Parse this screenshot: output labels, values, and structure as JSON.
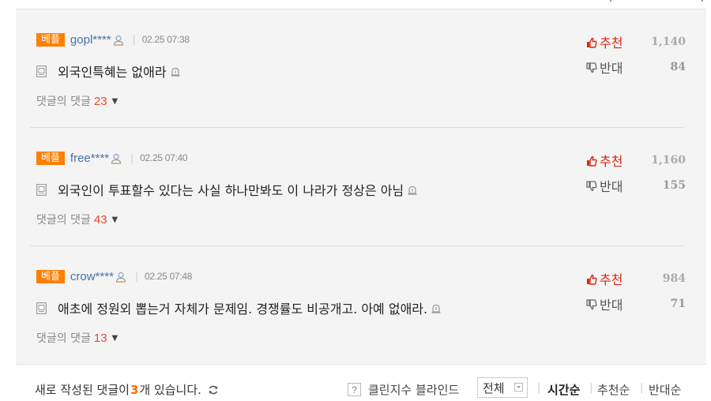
{
  "comments": [
    {
      "badge": "베플",
      "nickname": "gopl****",
      "date": "02.25 07:38",
      "text": "외국인특혜는 없애라",
      "replies_label": "댓글의 댓글",
      "replies_count": "23",
      "up_label": "추천",
      "up_count": "1,140",
      "down_label": "반대",
      "down_count": "84"
    },
    {
      "badge": "베플",
      "nickname": "free****",
      "date": "02.25 07:40",
      "text": "외국인이 투표할수 있다는 사실 하나만봐도 이 나라가 정상은 아님",
      "replies_label": "댓글의 댓글",
      "replies_count": "43",
      "up_label": "추천",
      "up_count": "1,160",
      "down_label": "반대",
      "down_count": "155"
    },
    {
      "badge": "베플",
      "nickname": "crow****",
      "date": "02.25 07:48",
      "text": "애초에 정원외 뽑는거 자체가 문제임. 경쟁률도 비공개고. 아예 없애라.",
      "replies_label": "댓글의 댓글",
      "replies_count": "13",
      "up_label": "추천",
      "up_count": "984",
      "down_label": "반대",
      "down_count": "71"
    }
  ],
  "footer": {
    "new_prefix": "새로 작성된 댓글이 ",
    "new_count": "3",
    "new_suffix": "개 있습니다.",
    "help_glyph": "?",
    "blind_label": "클린지수 블라인드",
    "blind_select": "전체",
    "sort_time": "시간순",
    "sort_up": "추천순",
    "sort_down": "반대순"
  },
  "colors": {
    "badge": "#ff7f00",
    "up": "#d7260f",
    "reply_count": "#e44c2c",
    "new_count": "#ff6a00"
  },
  "icons": {
    "user": "user-icon",
    "doc": "document-icon",
    "report": "report-bell-icon",
    "thumb_up": "thumbs-up-icon",
    "thumb_down": "thumbs-down-icon",
    "refresh": "refresh-icon",
    "caret": "caret-down-icon"
  }
}
